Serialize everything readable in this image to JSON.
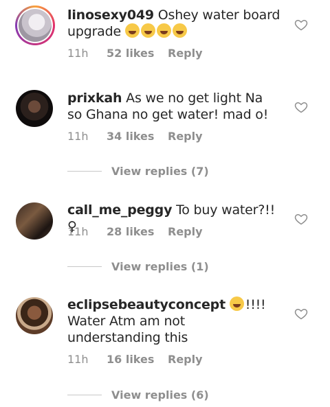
{
  "comments": [
    {
      "username": "linosexy049",
      "text": " Oshey water board upgrade",
      "emoji_count": 4,
      "time": "11h",
      "likes": "52 likes",
      "reply": "Reply",
      "view_replies": null
    },
    {
      "username": "prixkah",
      "text": " As we no get light Na so Ghana no get water! mad o!",
      "time": "11h",
      "likes": "34 likes",
      "reply": "Reply",
      "view_replies": "View replies (7)"
    },
    {
      "username": "call_me_peggy",
      "text": " To buy water?!!♀",
      "time": "11h",
      "likes": "28 likes",
      "reply": "Reply",
      "view_replies": "View replies (1)"
    },
    {
      "username": "eclipsebeautyconcept",
      "text_after_emoji": "!!!! Water Atm am not understanding this",
      "emoji_count": 1,
      "time": "11h",
      "likes": "16 likes",
      "reply": "Reply",
      "view_replies": "View replies (6)"
    }
  ],
  "icons": {
    "like": "heart-outline-icon",
    "emoji": "laughing-emoji-icon"
  },
  "colors": {
    "text": "#262626",
    "meta": "#8e8e8e",
    "story_ring": "#e1306c"
  }
}
